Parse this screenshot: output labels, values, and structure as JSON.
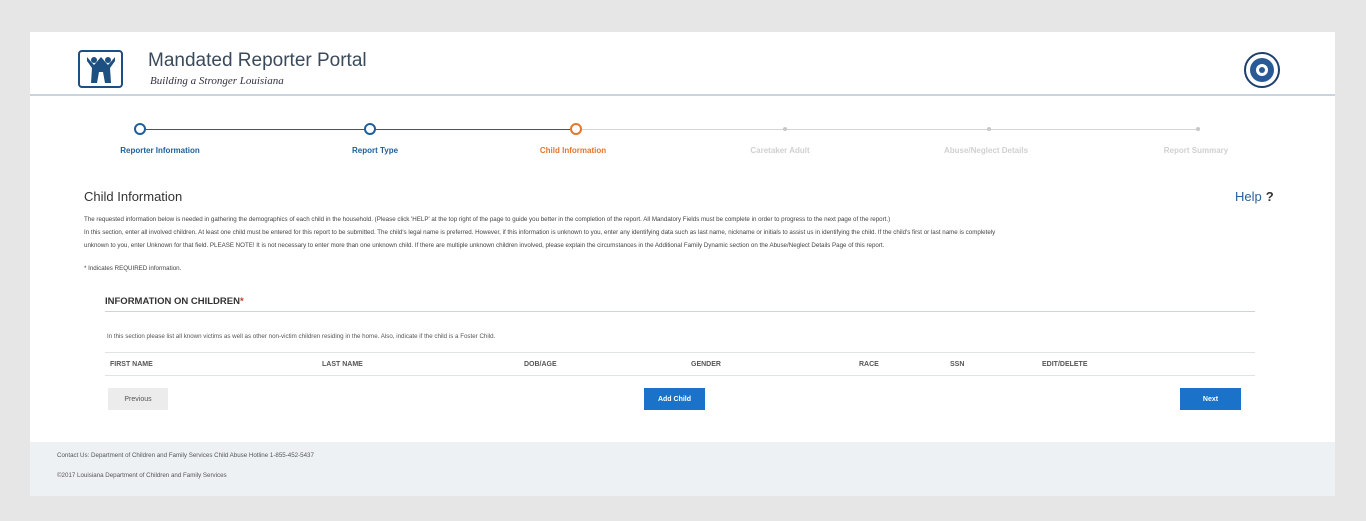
{
  "header": {
    "title": "Mandated Reporter Portal",
    "subtitle": "Building a Stronger Louisiana"
  },
  "stepper": {
    "steps": [
      {
        "label": "Reporter Information",
        "state": "completed"
      },
      {
        "label": "Report Type",
        "state": "completed"
      },
      {
        "label": "Child Information",
        "state": "current"
      },
      {
        "label": "Caretaker Adult",
        "state": "upcoming"
      },
      {
        "label": "Abuse/Neglect Details",
        "state": "upcoming"
      },
      {
        "label": "Report Summary",
        "state": "upcoming"
      }
    ],
    "colors": {
      "completed": "#1d5f9e",
      "current": "#e8742a",
      "upcoming": "#c8c8c8"
    }
  },
  "content": {
    "title": "Child Information",
    "help_label": "Help",
    "help_icon": "?",
    "intro_lines": [
      "The requested information below is needed in gathering the demographics of each child in the household. (Please click 'HELP' at the top right of the page to guide you better in the completion of the report. All Mandatory Fields must be complete in order to progress to the next page of the report.)",
      "In this section, enter all involved children. At least one child must be entered for this report to be submitted. The child's legal name is preferred. However, if this information is unknown to you, enter any identifying data such as last name, nickname or initials to assist us in identifying the child. If the child's first or last name is completely",
      "unknown to you, enter Unknown for that field. PLEASE NOTE! It is not necessary to enter more than one unknown child. If there are multiple unknown children involved, please explain the circumstances in the Additional Family Dynamic section on the Abuse/Neglect Details Page of this report."
    ],
    "required_note": "* Indicates REQUIRED information."
  },
  "children_section": {
    "heading": "INFORMATION ON CHILDREN",
    "required_marker": "*",
    "description": "In this section please list all known victims as well as other non-victim children residing in the home. Also, indicate if the child is a Foster Child.",
    "columns": [
      "FIRST NAME",
      "LAST NAME",
      "DOB/AGE",
      "GENDER",
      "RACE",
      "SSN",
      "EDIT/DELETE"
    ],
    "rows": []
  },
  "buttons": {
    "previous": "Previous",
    "add_child": "Add Child",
    "next": "Next"
  },
  "footer": {
    "contact": "Contact Us: Department of Children and Family Services Child Abuse Hotline 1-855-452-5437",
    "copyright": "©2017 Louisiana Department of Children and Family Services"
  }
}
